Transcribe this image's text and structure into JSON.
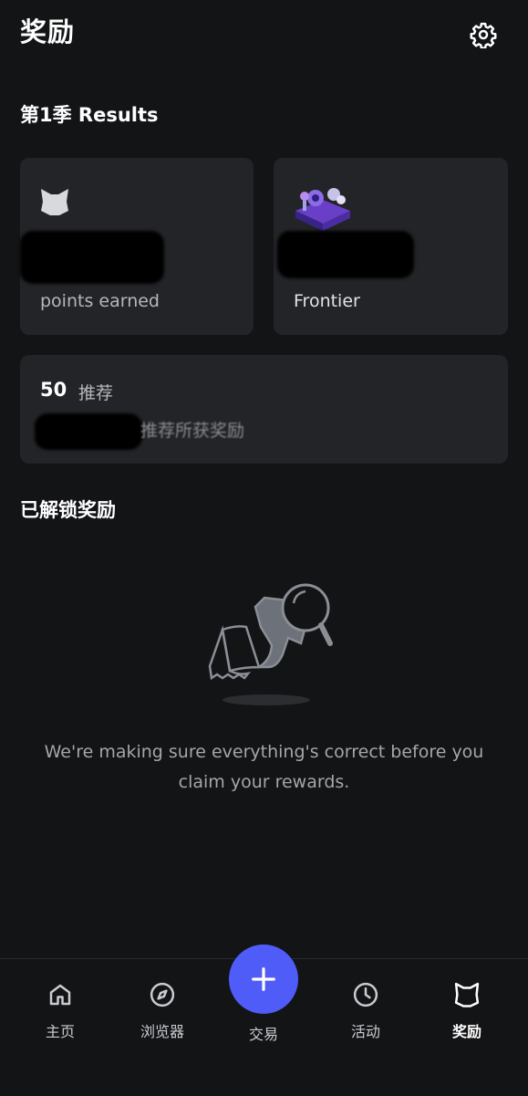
{
  "header": {
    "title": "奖励",
    "settings_icon": "gear-icon"
  },
  "season": {
    "title": "第1季 Results",
    "points_card": {
      "icon": "fox-logo-icon",
      "label": "points earned"
    },
    "tier_card": {
      "icon": "frontier-island-icon",
      "label": "Frontier"
    },
    "referral_card": {
      "count": "50",
      "count_label": "推荐",
      "rewards_label": "推荐所获奖励"
    }
  },
  "unlocked": {
    "title": "已解锁奖励",
    "illustration": "search-document-illustration",
    "message": "We're making sure everything's correct before you claim your rewards."
  },
  "bottom_nav": {
    "items": [
      {
        "label": "主页",
        "icon": "home-icon"
      },
      {
        "label": "浏览器",
        "icon": "compass-icon"
      },
      {
        "label": "交易",
        "icon": "plus-icon"
      },
      {
        "label": "活动",
        "icon": "clock-icon"
      },
      {
        "label": "奖励",
        "icon": "fox-logo-icon"
      }
    ],
    "active": "奖励"
  },
  "colors": {
    "background": "#131416",
    "card": "#232427",
    "accent": "#4f5cf7",
    "muted_text": "#b5b7bc"
  }
}
